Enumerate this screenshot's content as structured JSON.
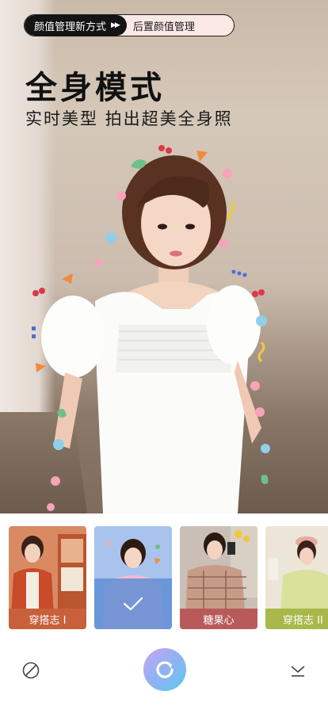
{
  "promo": {
    "left_label": "颜值管理新方式",
    "arrows": "▶▶",
    "right_label": "后置颜值管理"
  },
  "hero": {
    "title": "全身模式",
    "subtitle": "实时美型 拍出超美全身照"
  },
  "filters": [
    {
      "label": "穿搭志 I",
      "selected": false,
      "label_bg": "#c8603c"
    },
    {
      "label": "",
      "selected": true,
      "label_bg": "#5c8ed6"
    },
    {
      "label": "糖果心",
      "selected": false,
      "label_bg": "#b85a5a"
    },
    {
      "label": "穿搭志 II",
      "selected": false,
      "label_bg": "#a8b84a"
    }
  ],
  "icons": {
    "left": "no-filter-icon",
    "center": "refresh-shutter-icon",
    "right": "collapse-chevron-icon",
    "selected": "checkmark-icon"
  },
  "colors": {
    "accent_gradient_start": "#c7a6f1",
    "accent_gradient_end": "#5ec8ee",
    "selected_overlay": "#5c8ed6"
  }
}
